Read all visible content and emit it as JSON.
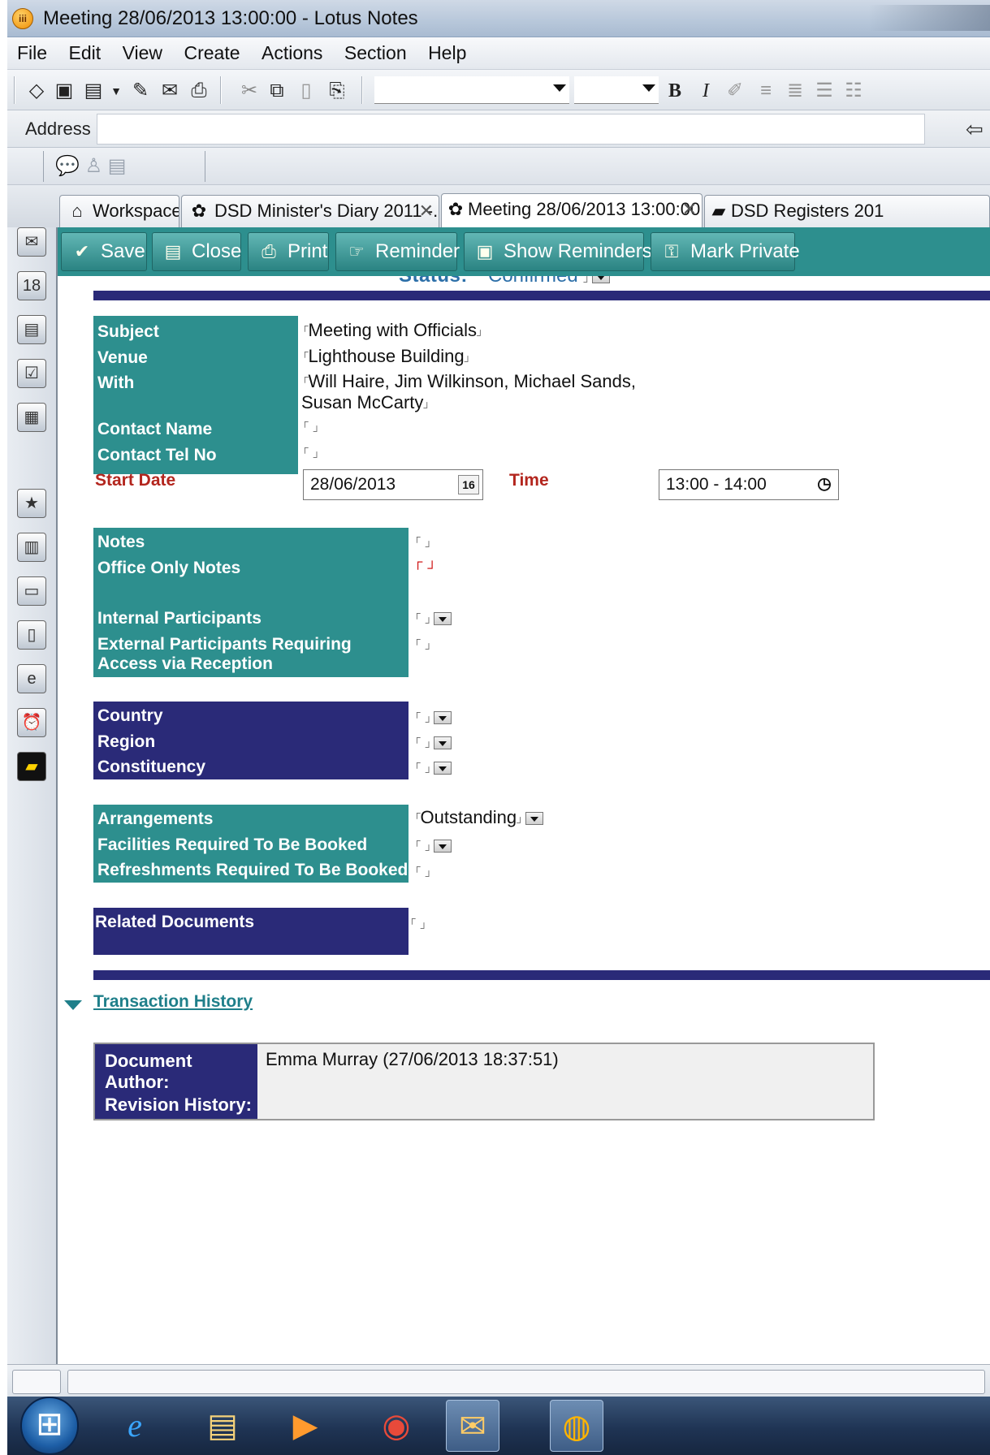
{
  "window": {
    "title": "Meeting 28/06/2013 13:00:00 - Lotus Notes",
    "app_icon": "lotus-notes-icon"
  },
  "menu": [
    "File",
    "Edit",
    "View",
    "Create",
    "Actions",
    "Section",
    "Help"
  ],
  "address": {
    "label": "Address",
    "value": ""
  },
  "tabs": [
    {
      "label": "Workspace",
      "icon": "workspace-icon"
    },
    {
      "label": "DSD Minister's Diary 2011 -...",
      "icon": "diary-icon"
    },
    {
      "label": "Meeting 28/06/2013 13:00:00",
      "icon": "meeting-icon"
    },
    {
      "label": "DSD Registers 201",
      "icon": "registers-icon"
    }
  ],
  "actions": [
    "Save",
    "Close",
    "Print",
    "Reminder",
    "Show Reminders",
    "Mark Private"
  ],
  "status": {
    "label": "Status:",
    "value": "Confirmed"
  },
  "fields": {
    "subject": {
      "label": "Subject",
      "value": "Meeting with Officials"
    },
    "venue": {
      "label": "Venue",
      "value": "Lighthouse Building"
    },
    "with": {
      "label": "With",
      "value_line1": "Will Haire, Jim Wilkinson, Michael Sands,",
      "value_line2": "Susan McCarty"
    },
    "contact_name": {
      "label": "Contact Name",
      "value": ""
    },
    "contact_tel": {
      "label": "Contact Tel No",
      "value": ""
    },
    "start_date": {
      "label": "Start Date",
      "value": "28/06/2013",
      "button": "16"
    },
    "time": {
      "label": "Time",
      "value": "13:00 - 14:00"
    },
    "notes": {
      "label": "Notes"
    },
    "office_only_notes": {
      "label": "Office Only Notes"
    },
    "internal_participants": {
      "label": "Internal Participants"
    },
    "external_participants": {
      "label_line1": "External Participants Requiring",
      "label_line2": "Access via Reception"
    },
    "country": {
      "label": "Country"
    },
    "region": {
      "label": "Region"
    },
    "constituency": {
      "label": "Constituency"
    },
    "arrangements": {
      "label": "Arrangements",
      "value": "Outstanding"
    },
    "facilities": {
      "label": "Facilities Required To Be Booked"
    },
    "refreshments": {
      "label": "Refreshments Required To Be Booked"
    },
    "related_documents": {
      "label": "Related Documents"
    }
  },
  "transaction_history": {
    "title": "Transaction History",
    "author_label": "Document Author:",
    "author_value": "Emma Murray (27/06/2013 18:37:51)",
    "revision_label": "Revision History:"
  },
  "colors": {
    "teal": "#2d8f8e",
    "navy": "#2a2a78",
    "label_red": "#b3261e",
    "link_teal": "#1f7f8a"
  },
  "taskbar": [
    "start-orb-icon",
    "internet-explorer-icon",
    "file-explorer-icon",
    "media-player-icon",
    "chrome-icon",
    "lotus-notes-taskbar-icon",
    "lotus-notes-active-icon"
  ]
}
